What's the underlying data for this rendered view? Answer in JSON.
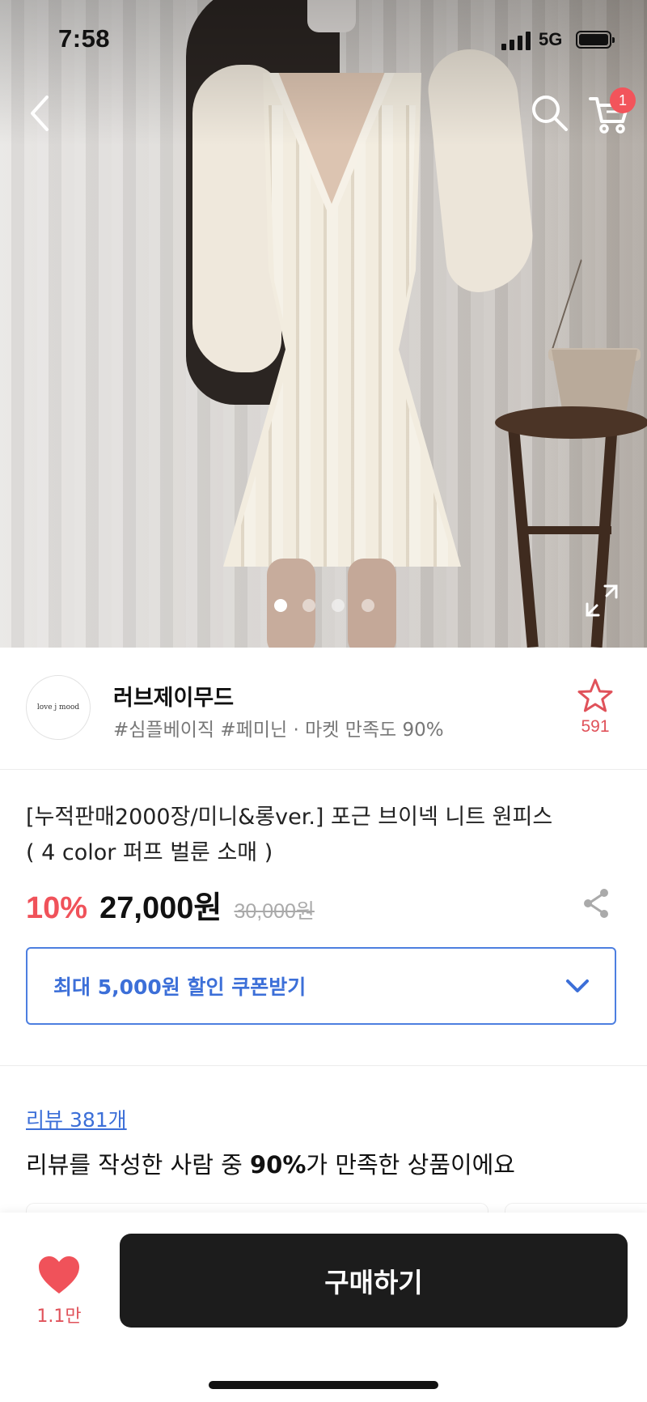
{
  "status_bar": {
    "time": "7:58",
    "network": "5G"
  },
  "nav": {
    "back_icon": "chevron-left-icon",
    "search_icon": "search-icon",
    "cart_icon": "cart-icon",
    "cart_badge": "1"
  },
  "carousel": {
    "total": 4,
    "active": 1
  },
  "seller": {
    "logo_text": "love j mood",
    "name": "러브제이무드",
    "tags": "#심플베이직 #페미닌 · 마켓 만족도 90%",
    "favorite_count": "591"
  },
  "product": {
    "title_line1": "[누적판매2000장/미니&롱ver.] 포근 브이넥 니트 원피스",
    "title_line2": "( 4 color 퍼프 벌룬 소매 )",
    "discount": "10%",
    "price": "27,000원",
    "original_price": "30,000원"
  },
  "coupon": {
    "label": "최대 5,000원 할인 쿠폰받기"
  },
  "reviews": {
    "link": "리뷰 381개",
    "summary_prefix": "리뷰를 작성한 사람 중 ",
    "summary_highlight": "90%",
    "summary_suffix": "가 만족한 상품이에요"
  },
  "bottom": {
    "like_count": "1.1만",
    "buy_label": "구매하기"
  },
  "colors": {
    "accent_red": "#f0525a",
    "accent_blue": "#3c6fd8",
    "buy_button": "#1c1c1c"
  }
}
